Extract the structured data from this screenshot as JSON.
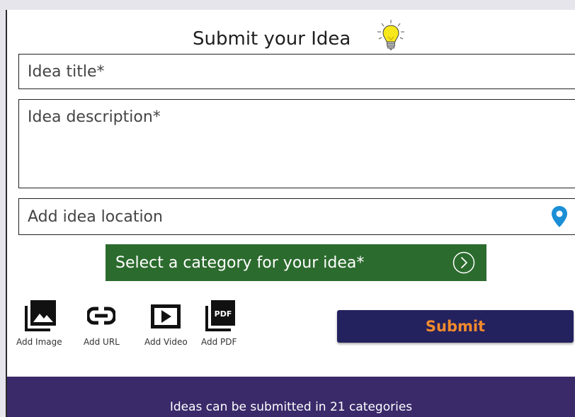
{
  "form": {
    "title": "Submit your Idea",
    "title_icon": "lightbulb-icon",
    "idea_title_placeholder": "Idea title*",
    "idea_description_placeholder": "Idea description*",
    "location_placeholder": "Add idea location",
    "location_icon": "map-pin-icon",
    "category_label": "Select a category for your idea*",
    "category_icon": "chevron-right-circle-icon",
    "submit_label": "Submit"
  },
  "attachments": [
    {
      "label": "Add Image",
      "icon": "image-icon"
    },
    {
      "label": "Add URL",
      "icon": "link-icon"
    },
    {
      "label": "Add Video",
      "icon": "video-icon"
    },
    {
      "label": "Add PDF",
      "icon": "pdf-icon"
    }
  ],
  "footer": {
    "text": "Ideas can be submitted in 21 categories"
  },
  "colors": {
    "category_bg": "#2c6b2e",
    "submit_bg": "#24215f",
    "submit_text": "#f28b2c",
    "footer_bg": "#3a2a6a",
    "pin": "#1b8fd6"
  }
}
